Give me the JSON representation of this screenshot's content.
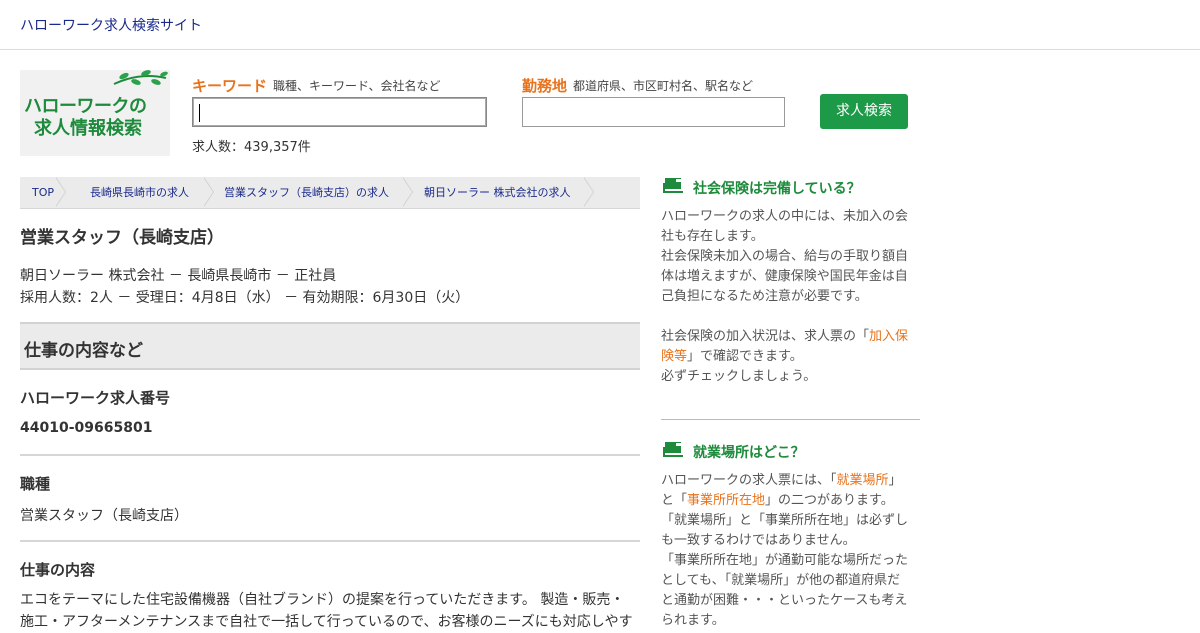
{
  "header": {
    "site_title": "ハローワーク求人検索サイト"
  },
  "logo": {
    "line1": "ハローワークの",
    "line2": "求人情報検索"
  },
  "search": {
    "keyword_label": "キーワード",
    "keyword_hint": "職種、キーワード、会社名など",
    "keyword_value": "",
    "location_label": "勤務地",
    "location_hint": "都道府県、市区町村名、駅名など",
    "location_value": "",
    "button_label": "求人検索",
    "count_text": "求人数：439,357件"
  },
  "breadcrumb": [
    "TOP",
    "長崎県長崎市の求人",
    "営業スタッフ（長崎支店）の求人",
    "朝日ソーラー 株式会社の求人"
  ],
  "job": {
    "title": "営業スタッフ（長崎支店）",
    "meta_line1": "朝日ソーラー 株式会社 － 長崎県長崎市 － 正社員",
    "meta_line2": "採用人数：2人 － 受理日：4月8日（水） － 有効期限：6月30日（火）"
  },
  "section": {
    "heading": "仕事の内容など",
    "number_label": "ハローワーク求人番号",
    "number_value": "44010-09665801",
    "type_label": "職種",
    "type_value": "営業スタッフ（長崎支店）",
    "content_label": "仕事の内容",
    "content_line1": "エコをテーマにした住宅設備機器（自社ブランド）の提案を行っていただきます。 製造・販売・",
    "content_line2": "施工・アフターメンテナンスまで自社で一括して行っているので、お客様のニーズにも対応しやす"
  },
  "sidebar": {
    "insurance": {
      "heading": "社会保険は完備している？",
      "l1": "ハローワークの求人の中には、未加入の会",
      "l2": "社も存在します。",
      "l3": "社会保険未加入の場合、給与の手取り額自",
      "l4": "体は増えますが、健康保険や国民年金は自",
      "l5": "己負担になるため注意が必要です。",
      "l6_pre": "社会保険の加入状況は、求人票の「",
      "l6_link": "加入保",
      "l7_link": "険等",
      "l7_post": "」で確認できます。",
      "l8": "必ずチェックしましょう。"
    },
    "location": {
      "heading": "就業場所はどこ？",
      "l1_pre": "ハローワークの求人票には、「",
      "l1_link": "就業場所",
      "l1_post": "」",
      "l2_pre": "と「",
      "l2_link": "事業所所在地",
      "l2_post": "」の二つがあります。",
      "l3": "「就業場所」と「事業所所在地」は必ずし",
      "l4": "も一致するわけではありません。",
      "l5": "「事業所所在地」が通勤可能な場所だった",
      "l6": "としても、「就業場所」が他の都道府県だ",
      "l7": "と通勤が困難・・・といったケースも考え",
      "l8": "られます。"
    }
  },
  "colors": {
    "accent_orange": "#e8731c",
    "brand_green": "#1c9a48",
    "link_blue": "#1a2a8c"
  }
}
